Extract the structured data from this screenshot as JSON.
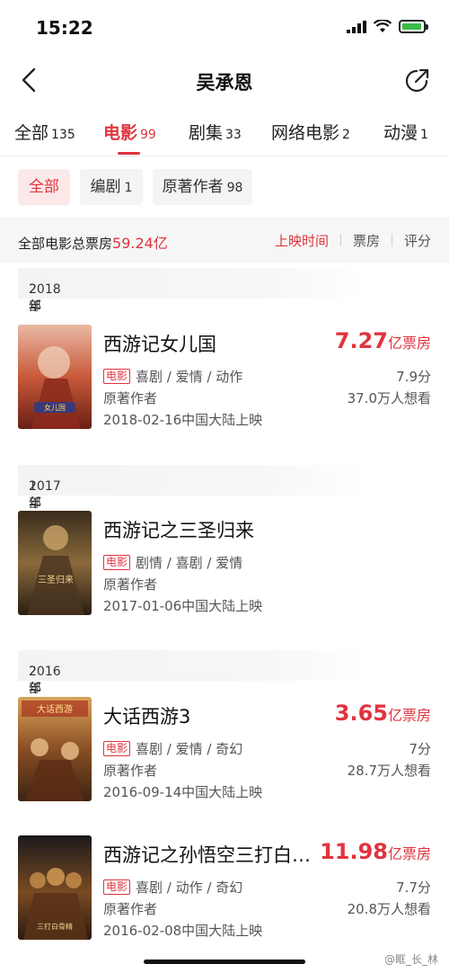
{
  "status": {
    "time": "15:22"
  },
  "nav": {
    "title": "吴承恩"
  },
  "tabs": [
    {
      "label": "全部",
      "count": "135"
    },
    {
      "label": "电影",
      "count": "99"
    },
    {
      "label": "剧集",
      "count": "33"
    },
    {
      "label": "网络电影",
      "count": "2"
    },
    {
      "label": "动漫",
      "count": "1"
    }
  ],
  "chips": [
    {
      "label": "全部",
      "count": ""
    },
    {
      "label": "编剧",
      "count": "1"
    },
    {
      "label": "原著作者",
      "count": "98"
    }
  ],
  "summary": {
    "label": "全部电影总票房",
    "total": "59.24亿",
    "sort_options": [
      "上映时间",
      "票房",
      "评分"
    ]
  },
  "years": [
    {
      "year": "2018年",
      "count": "2部"
    },
    {
      "year": "2017年",
      "count": "1部"
    },
    {
      "year": "2016年",
      "count": "2部"
    }
  ],
  "movies": [
    {
      "title": "西游记女儿国",
      "box_office": "7.27",
      "box_unit": "亿票房",
      "badge": "电影",
      "genres": "喜剧 / 爱情 / 动作",
      "role": "原著作者",
      "release": "2018-02-16中国大陆上映",
      "rating": "7.9分",
      "wants": "37.0万人想看",
      "poster_text": "女儿国"
    },
    {
      "title": "西游记之三圣归来",
      "box_office": "",
      "box_unit": "",
      "badge": "电影",
      "genres": "剧情 / 喜剧 / 爱情",
      "role": "原著作者",
      "release": "2017-01-06中国大陆上映",
      "rating": "",
      "wants": "",
      "poster_text": "三圣归来"
    },
    {
      "title": "大话西游3",
      "box_office": "3.65",
      "box_unit": "亿票房",
      "badge": "电影",
      "genres": "喜剧 / 爱情 / 奇幻",
      "role": "原著作者",
      "release": "2016-09-14中国大陆上映",
      "rating": "7分",
      "wants": "28.7万人想看",
      "poster_text": "大话西游"
    },
    {
      "title": "西游记之孙悟空三打白…",
      "box_office": "11.98",
      "box_unit": "亿票房",
      "badge": "电影",
      "genres": "喜剧 / 动作 / 奇幻",
      "role": "原著作者",
      "release": "2016-02-08中国大陆上映",
      "rating": "7.7分",
      "wants": "20.8万人想看",
      "poster_text": "三打白骨精"
    }
  ],
  "watermark": "@眶_长_林",
  "colors": {
    "accent": "#e0343f",
    "battery": "#3dbb4a"
  }
}
